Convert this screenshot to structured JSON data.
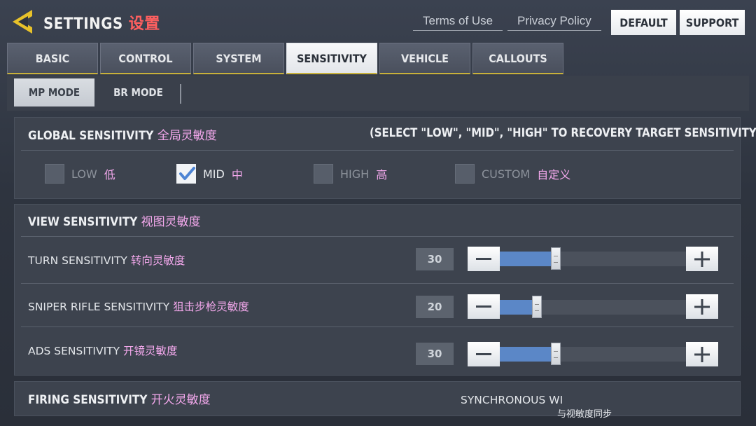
{
  "header": {
    "title": "SETTINGS",
    "title_cn": "设置",
    "terms_link": "Terms of Use",
    "privacy_link": "Privacy Policy",
    "default_button": "DEFAULT",
    "support_button": "SUPPORT"
  },
  "main_tabs": [
    {
      "label": "BASIC"
    },
    {
      "label": "CONTROL"
    },
    {
      "label": "SYSTEM"
    },
    {
      "label": "SENSITIVITY",
      "active": true
    },
    {
      "label": "VEHICLE"
    },
    {
      "label": "CALLOUTS"
    }
  ],
  "sub_tabs": [
    {
      "label": "MP MODE",
      "active": true
    },
    {
      "label": "BR MODE"
    }
  ],
  "global": {
    "title": "GLOBAL SENSITIVITY",
    "title_cn": "全局灵敏度",
    "hint": "(SELECT \"LOW\", \"MID\", \"HIGH\" TO RECOVERY TARGET SENSITIVITY)",
    "options": [
      {
        "label": "LOW",
        "label_cn": "低",
        "checked": false
      },
      {
        "label": "MID",
        "label_cn": "中",
        "checked": true
      },
      {
        "label": "HIGH",
        "label_cn": "高",
        "checked": false
      },
      {
        "label": "CUSTOM",
        "label_cn": "自定义",
        "checked": false
      }
    ]
  },
  "view": {
    "title": "VIEW SENSITIVITY",
    "title_cn": "视图灵敏度",
    "rows": [
      {
        "label": "TURN SENSITIVITY",
        "label_cn": "转向灵敏度",
        "value": "30",
        "fraction": 0.3
      },
      {
        "label": "SNIPER RIFLE SENSITIVITY",
        "label_cn": "狙击步枪灵敏度",
        "value": "20",
        "fraction": 0.2
      },
      {
        "label": "ADS SENSITIVITY",
        "label_cn": "开镜灵敏度",
        "value": "30",
        "fraction": 0.3
      }
    ]
  },
  "firing": {
    "title": "FIRING SENSITIVITY",
    "title_cn": "开火灵敏度",
    "sync_label": "SYNCHRONOUS WI",
    "sync_label_cn": "与视敏度同步"
  },
  "colors": {
    "accent_yellow": "#e8c22a",
    "title_red": "#ff5f5f",
    "cn_pink": "#f3a8ec",
    "slider_fill": "#5b87c7"
  }
}
